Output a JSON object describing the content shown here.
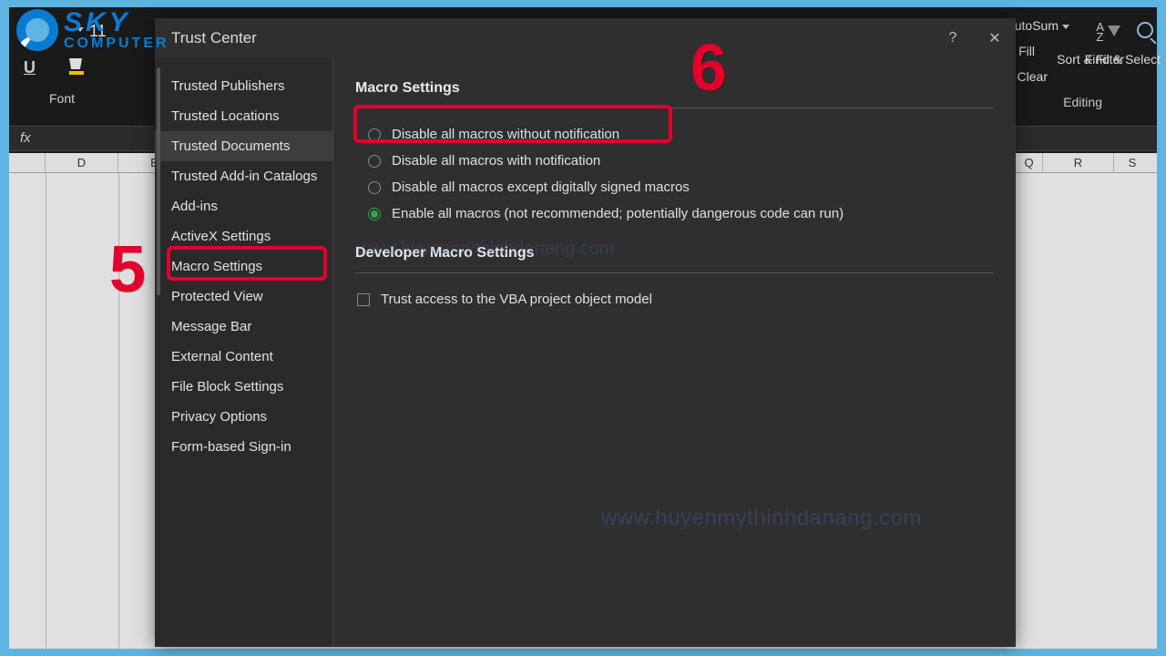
{
  "ribbon": {
    "font_group_label": "Font",
    "font_size": "11",
    "underline_icon": "U",
    "autosum": "AutoSum",
    "fill": "Fill",
    "clear": "Clear",
    "sort_filter": "Sort & Filter",
    "find_select": "Find & Select",
    "editing_label": "Editing",
    "az": "A\nZ"
  },
  "formula_bar": {
    "fx": "fx"
  },
  "columns_left": [
    "D",
    "E"
  ],
  "columns_right": [
    "Q",
    "R",
    "S"
  ],
  "dialog": {
    "title": "Trust Center",
    "help": "?",
    "close": "✕",
    "sidebar": [
      "Trusted Publishers",
      "Trusted Locations",
      "Trusted Documents",
      "Trusted Add-in Catalogs",
      "Add-ins",
      "ActiveX Settings",
      "Macro Settings",
      "Protected View",
      "Message Bar",
      "External Content",
      "File Block Settings",
      "Privacy Options",
      "Form-based Sign-in"
    ],
    "selected_index": 6,
    "macro_settings_heading": "Macro Settings",
    "macro_options": [
      "Disable all macros without notification",
      "Disable all macros with notification",
      "Disable all macros except digitally signed macros",
      "Enable all macros (not recommended; potentially dangerous code can run)"
    ],
    "macro_selected_index": 3,
    "developer_heading": "Developer Macro Settings",
    "vba_trust_label": "Trust access to the VBA project object model"
  },
  "annotations": {
    "five": "5",
    "six": "6"
  },
  "watermark": "www.huyenmythinhdanang.com",
  "logo": {
    "sky": "SKY",
    "computer": "COMPUTER"
  }
}
